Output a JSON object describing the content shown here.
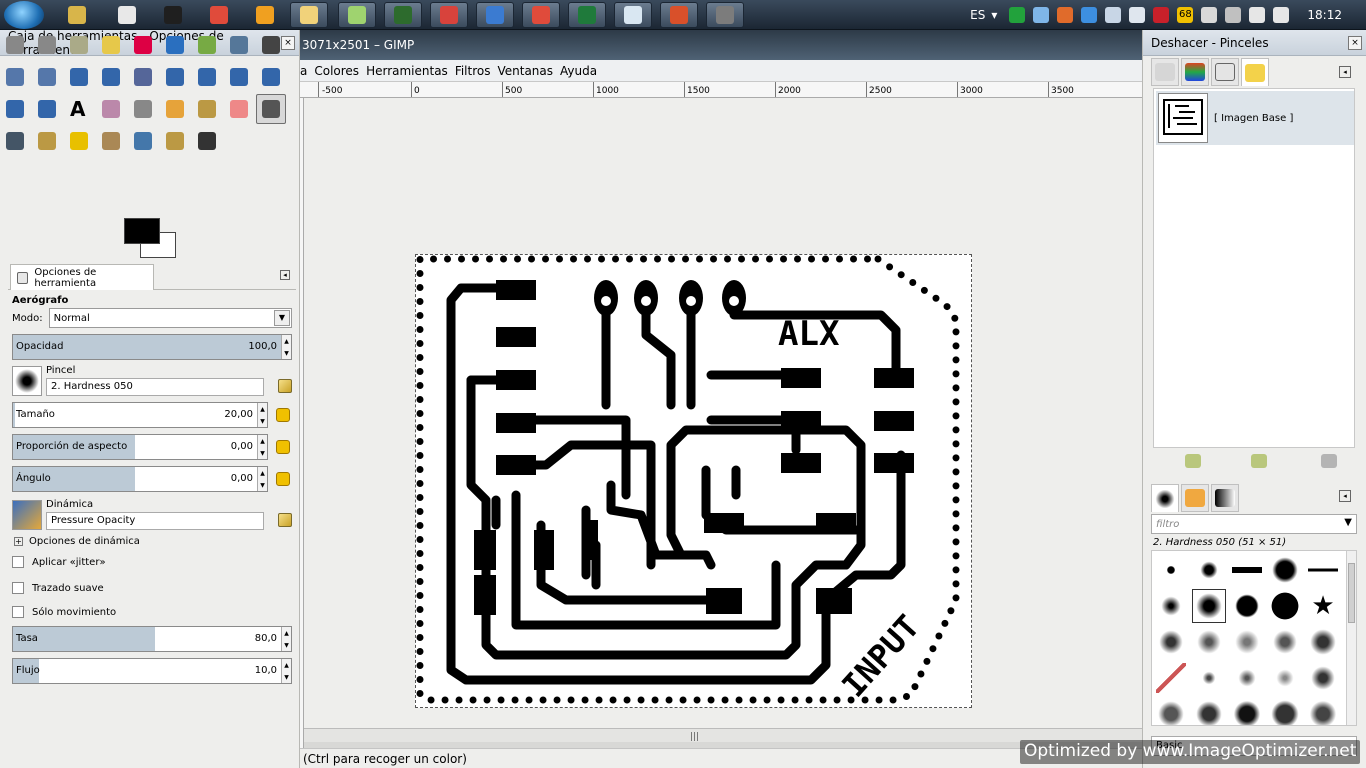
{
  "taskbar": {
    "apps": [
      {
        "name": "app-icon-1",
        "color": "#d8b54a"
      },
      {
        "name": "app-icon-2",
        "color": "#e8e8e8"
      },
      {
        "name": "app-icon-3",
        "color": "#1f1f1f"
      },
      {
        "name": "chrome-icon",
        "color": "#e04b3b"
      },
      {
        "name": "media-icon",
        "color": "#f0a020"
      },
      {
        "name": "explorer-icon",
        "color": "#f1d27a"
      },
      {
        "name": "chat-icon",
        "color": "#9fd36f"
      },
      {
        "name": "terminal-icon",
        "color": "#2d6b2d"
      },
      {
        "name": "app-red-icon",
        "color": "#d8433c"
      },
      {
        "name": "app-blue-icon",
        "color": "#3b7bd1"
      },
      {
        "name": "chrome-icon-2",
        "color": "#e04b3b"
      },
      {
        "name": "excel-icon",
        "color": "#1f7a3b"
      },
      {
        "name": "notes-icon",
        "color": "#d9e7f2"
      },
      {
        "name": "powerpoint-icon",
        "color": "#d9502a"
      },
      {
        "name": "gimp-icon",
        "color": "#7c7c7c"
      }
    ],
    "lang": "ES",
    "clock": "18:12",
    "battery_badge": "68"
  },
  "left_dock": {
    "title": "Caja de herramientas - Opciones de herramienta",
    "tab_label": "Opciones de herramienta",
    "tool_title": "Aerógrafo",
    "mode_label": "Modo:",
    "mode_value": "Normal",
    "opacity_label": "Opacidad",
    "opacity_value": "100,0",
    "opacity_fill": 1.0,
    "brush_label": "Pincel",
    "brush_value": "2. Hardness 050",
    "size_label": "Tamaño",
    "size_value": "20,00",
    "aspect_label": "Proporción de aspecto",
    "aspect_value": "0,00",
    "angle_label": "Ángulo",
    "angle_value": "0,00",
    "dynamics_label": "Dinámica",
    "dynamics_value": "Pressure Opacity",
    "dynamics_options_label": "Opciones de dinámica",
    "jitter_label": "Aplicar «jitter»",
    "smooth_label": "Trazado suave",
    "motion_label": "Sólo movimiento",
    "rate_label": "Tasa",
    "rate_value": "80,0",
    "flow_label": "Flujo",
    "flow_value": "10,0"
  },
  "image_window": {
    "title": "3071x2501 – GIMP",
    "menus": [
      "a",
      "Colores",
      "Herramientas",
      "Filtros",
      "Ventanas",
      "Ayuda"
    ],
    "ruler_ticks": [
      "-500",
      "0",
      "500",
      "1000",
      "1500",
      "2000",
      "2500",
      "3000",
      "3500"
    ],
    "status": "(Ctrl para recoger un color)",
    "pcb_text_top": "ALX",
    "pcb_text_corner": "INPUT"
  },
  "right_dock": {
    "title": "Deshacer - Pinceles",
    "undo_item": "[ Imagen Base ]",
    "filter_placeholder": "filtro",
    "brush_name": "2. Hardness 050 (51 × 51)",
    "brush_set": "Basic"
  },
  "watermark": "Optimized by www.ImageOptimizer.net"
}
